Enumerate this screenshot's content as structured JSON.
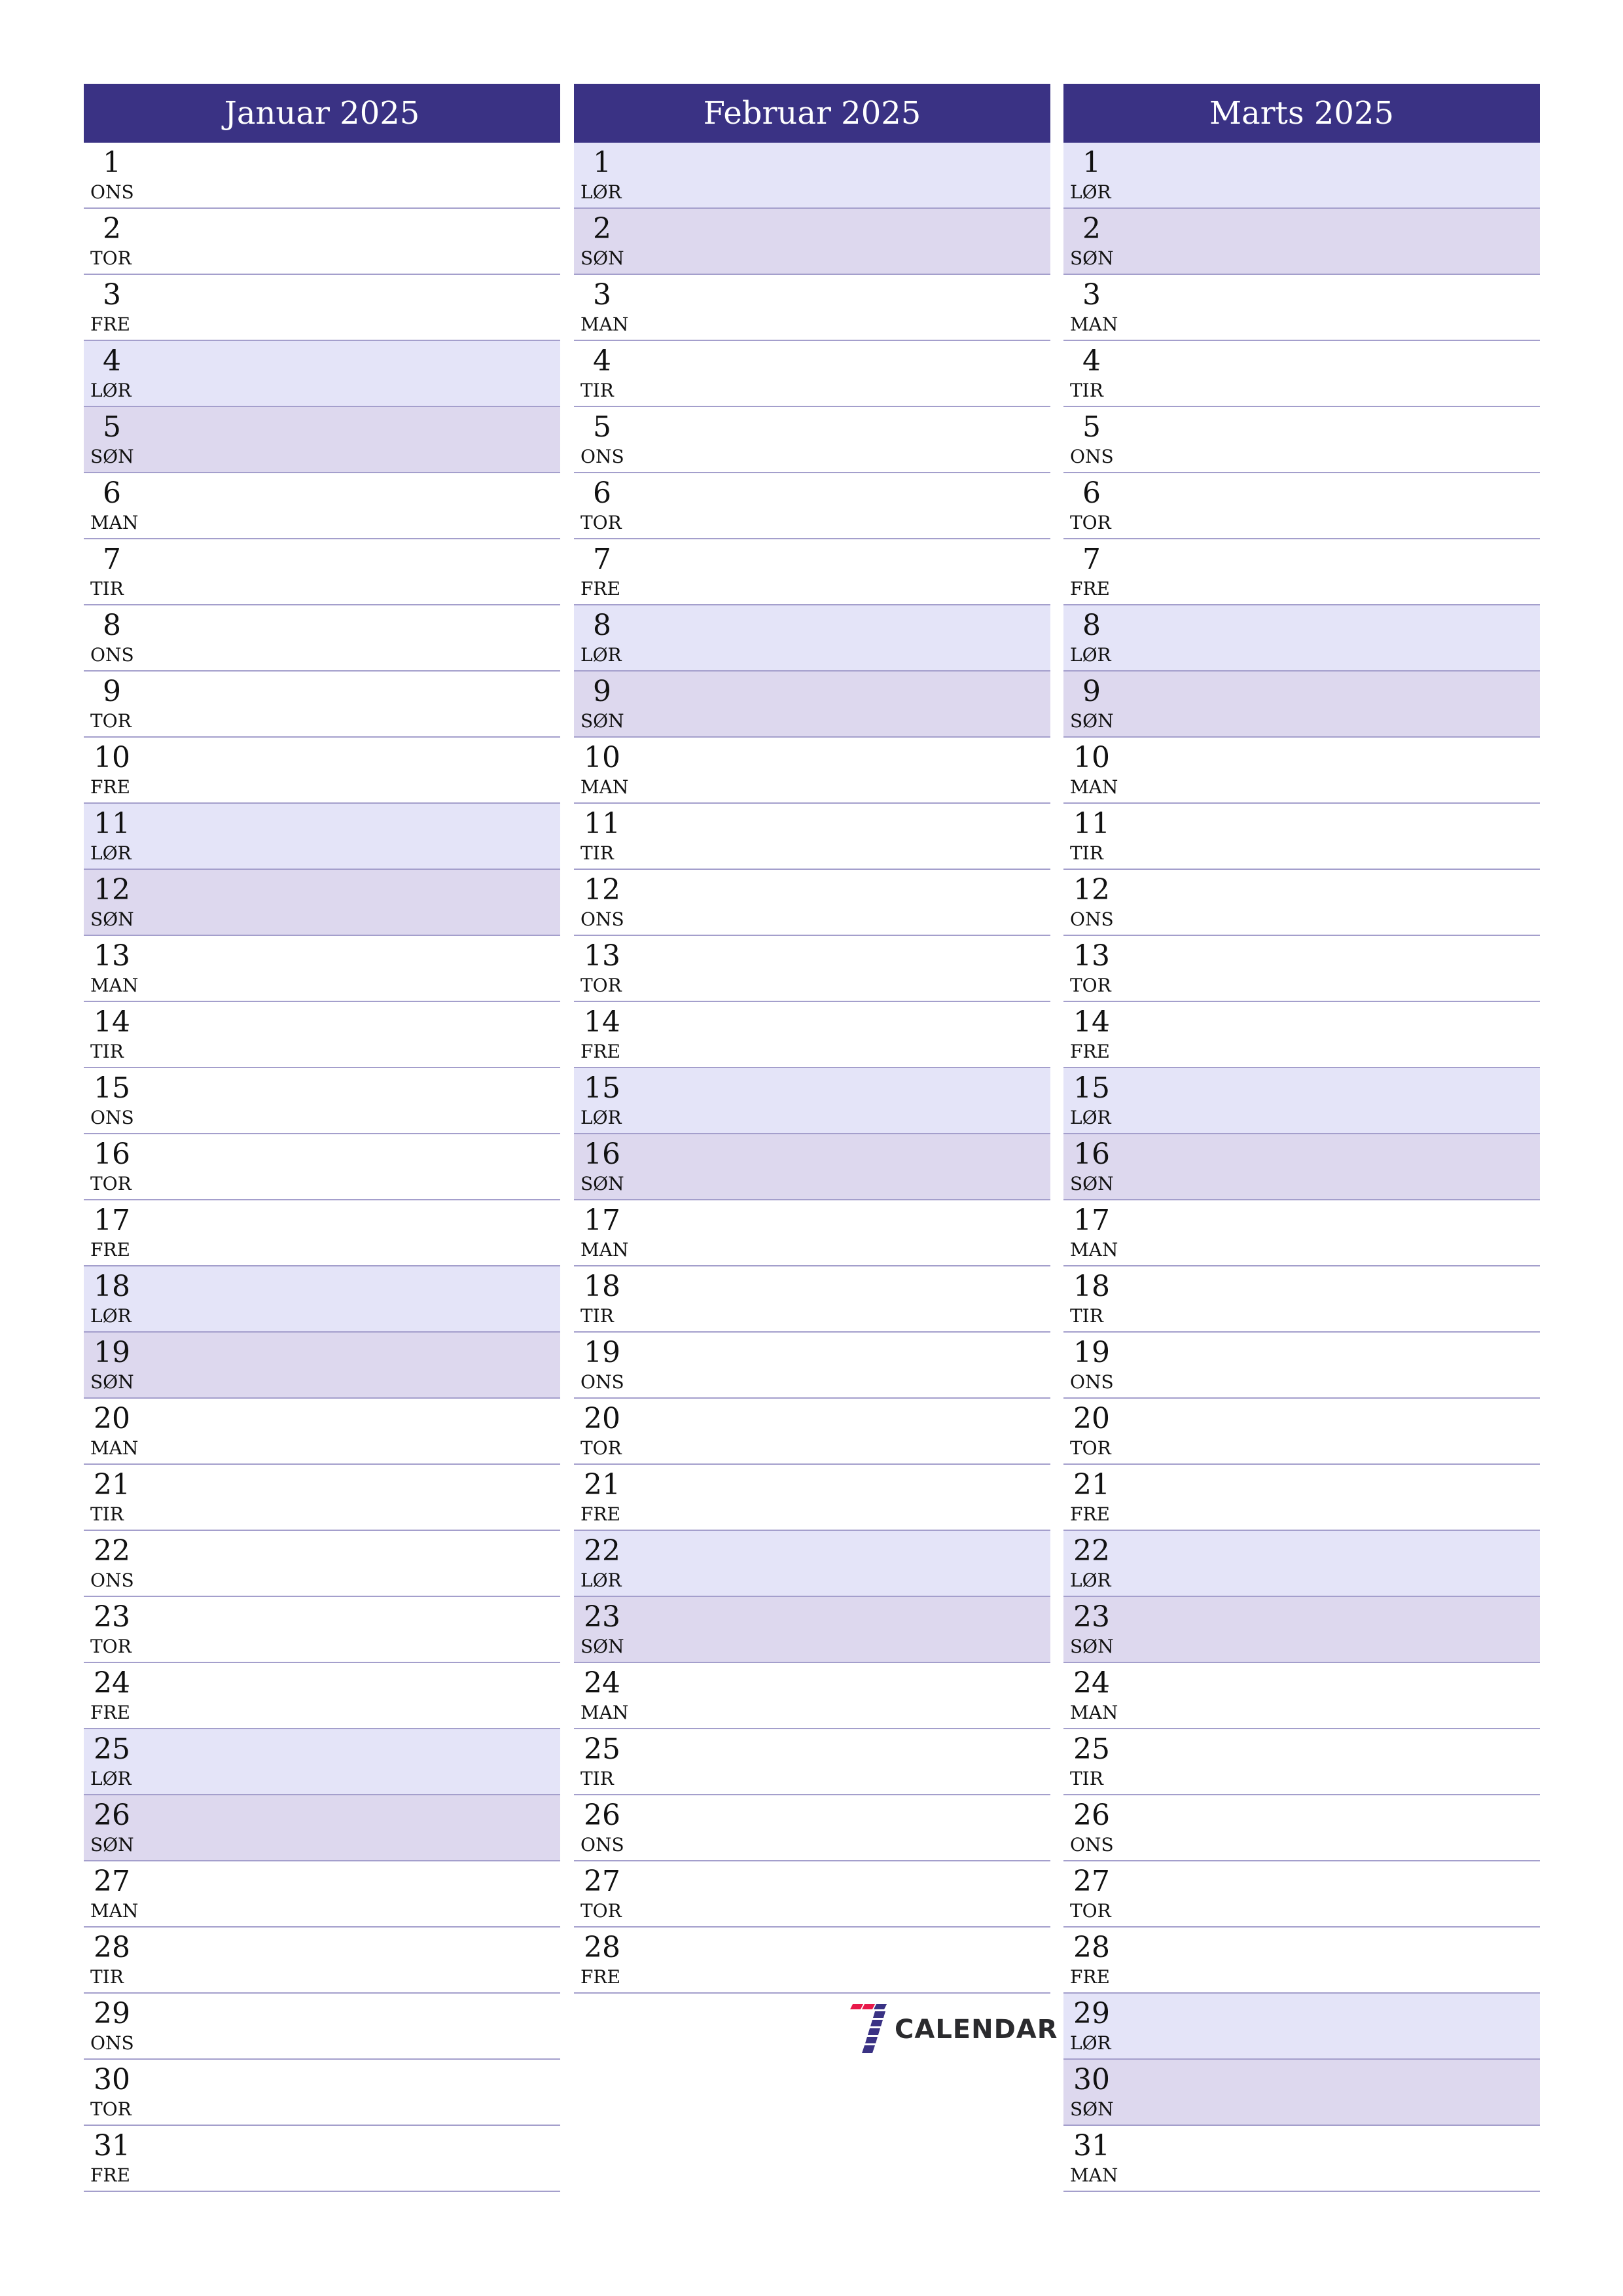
{
  "months": [
    {
      "title": "Januar 2025",
      "days": [
        {
          "n": "1",
          "d": "ONS"
        },
        {
          "n": "2",
          "d": "TOR"
        },
        {
          "n": "3",
          "d": "FRE"
        },
        {
          "n": "4",
          "d": "LØR"
        },
        {
          "n": "5",
          "d": "SØN"
        },
        {
          "n": "6",
          "d": "MAN"
        },
        {
          "n": "7",
          "d": "TIR"
        },
        {
          "n": "8",
          "d": "ONS"
        },
        {
          "n": "9",
          "d": "TOR"
        },
        {
          "n": "10",
          "d": "FRE"
        },
        {
          "n": "11",
          "d": "LØR"
        },
        {
          "n": "12",
          "d": "SØN"
        },
        {
          "n": "13",
          "d": "MAN"
        },
        {
          "n": "14",
          "d": "TIR"
        },
        {
          "n": "15",
          "d": "ONS"
        },
        {
          "n": "16",
          "d": "TOR"
        },
        {
          "n": "17",
          "d": "FRE"
        },
        {
          "n": "18",
          "d": "LØR"
        },
        {
          "n": "19",
          "d": "SØN"
        },
        {
          "n": "20",
          "d": "MAN"
        },
        {
          "n": "21",
          "d": "TIR"
        },
        {
          "n": "22",
          "d": "ONS"
        },
        {
          "n": "23",
          "d": "TOR"
        },
        {
          "n": "24",
          "d": "FRE"
        },
        {
          "n": "25",
          "d": "LØR"
        },
        {
          "n": "26",
          "d": "SØN"
        },
        {
          "n": "27",
          "d": "MAN"
        },
        {
          "n": "28",
          "d": "TIR"
        },
        {
          "n": "29",
          "d": "ONS"
        },
        {
          "n": "30",
          "d": "TOR"
        },
        {
          "n": "31",
          "d": "FRE"
        }
      ]
    },
    {
      "title": "Februar 2025",
      "days": [
        {
          "n": "1",
          "d": "LØR"
        },
        {
          "n": "2",
          "d": "SØN"
        },
        {
          "n": "3",
          "d": "MAN"
        },
        {
          "n": "4",
          "d": "TIR"
        },
        {
          "n": "5",
          "d": "ONS"
        },
        {
          "n": "6",
          "d": "TOR"
        },
        {
          "n": "7",
          "d": "FRE"
        },
        {
          "n": "8",
          "d": "LØR"
        },
        {
          "n": "9",
          "d": "SØN"
        },
        {
          "n": "10",
          "d": "MAN"
        },
        {
          "n": "11",
          "d": "TIR"
        },
        {
          "n": "12",
          "d": "ONS"
        },
        {
          "n": "13",
          "d": "TOR"
        },
        {
          "n": "14",
          "d": "FRE"
        },
        {
          "n": "15",
          "d": "LØR"
        },
        {
          "n": "16",
          "d": "SØN"
        },
        {
          "n": "17",
          "d": "MAN"
        },
        {
          "n": "18",
          "d": "TIR"
        },
        {
          "n": "19",
          "d": "ONS"
        },
        {
          "n": "20",
          "d": "TOR"
        },
        {
          "n": "21",
          "d": "FRE"
        },
        {
          "n": "22",
          "d": "LØR"
        },
        {
          "n": "23",
          "d": "SØN"
        },
        {
          "n": "24",
          "d": "MAN"
        },
        {
          "n": "25",
          "d": "TIR"
        },
        {
          "n": "26",
          "d": "ONS"
        },
        {
          "n": "27",
          "d": "TOR"
        },
        {
          "n": "28",
          "d": "FRE"
        }
      ]
    },
    {
      "title": "Marts 2025",
      "days": [
        {
          "n": "1",
          "d": "LØR"
        },
        {
          "n": "2",
          "d": "SØN"
        },
        {
          "n": "3",
          "d": "MAN"
        },
        {
          "n": "4",
          "d": "TIR"
        },
        {
          "n": "5",
          "d": "ONS"
        },
        {
          "n": "6",
          "d": "TOR"
        },
        {
          "n": "7",
          "d": "FRE"
        },
        {
          "n": "8",
          "d": "LØR"
        },
        {
          "n": "9",
          "d": "SØN"
        },
        {
          "n": "10",
          "d": "MAN"
        },
        {
          "n": "11",
          "d": "TIR"
        },
        {
          "n": "12",
          "d": "ONS"
        },
        {
          "n": "13",
          "d": "TOR"
        },
        {
          "n": "14",
          "d": "FRE"
        },
        {
          "n": "15",
          "d": "LØR"
        },
        {
          "n": "16",
          "d": "SØN"
        },
        {
          "n": "17",
          "d": "MAN"
        },
        {
          "n": "18",
          "d": "TIR"
        },
        {
          "n": "19",
          "d": "ONS"
        },
        {
          "n": "20",
          "d": "TOR"
        },
        {
          "n": "21",
          "d": "FRE"
        },
        {
          "n": "22",
          "d": "LØR"
        },
        {
          "n": "23",
          "d": "SØN"
        },
        {
          "n": "24",
          "d": "MAN"
        },
        {
          "n": "25",
          "d": "TIR"
        },
        {
          "n": "26",
          "d": "ONS"
        },
        {
          "n": "27",
          "d": "TOR"
        },
        {
          "n": "28",
          "d": "FRE"
        },
        {
          "n": "29",
          "d": "LØR"
        },
        {
          "n": "30",
          "d": "SØN"
        },
        {
          "n": "31",
          "d": "MAN"
        }
      ]
    }
  ],
  "weekend": {
    "saturday": "LØR",
    "sunday": "SØN"
  },
  "colors": {
    "header": "#3a3284",
    "saturday": "#e4e4f8",
    "sunday": "#ddd8ee",
    "logo_red": "#e8194a",
    "logo_blue": "#3a3284"
  },
  "logo": {
    "text": "CALENDAR",
    "icon": "seven-icon"
  }
}
